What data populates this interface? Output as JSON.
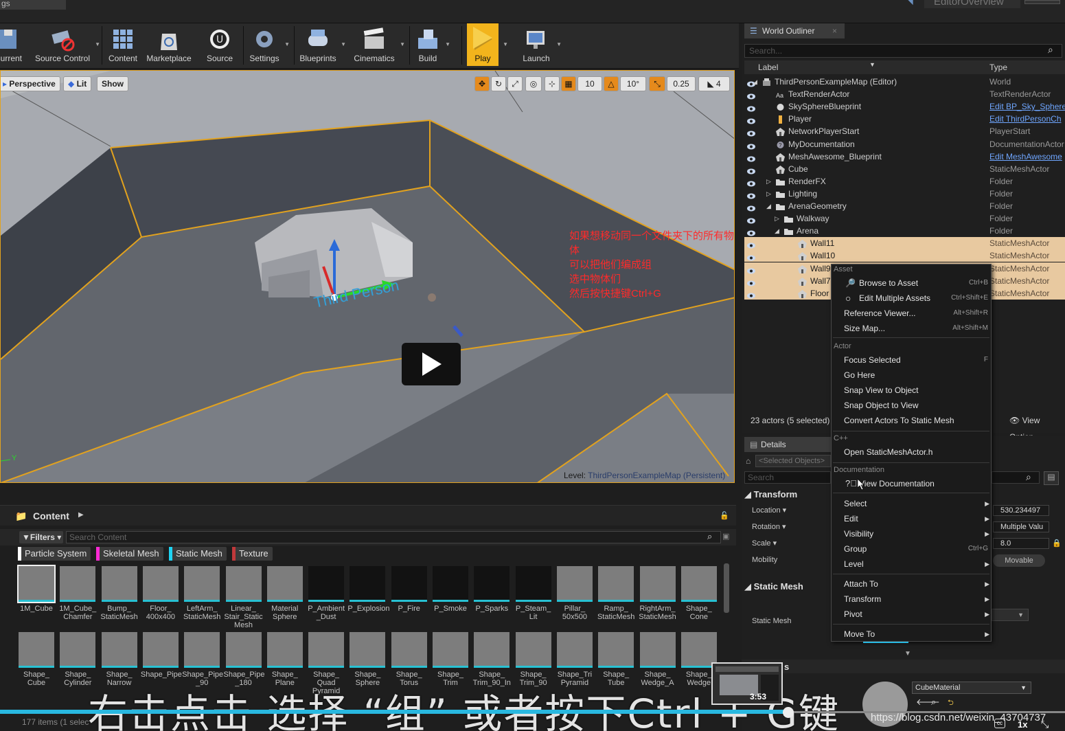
{
  "top": {
    "tab_fragment": "gs",
    "right_tab_fragment": "EditorOverview"
  },
  "toolbar": {
    "items": [
      {
        "label": "Current"
      },
      {
        "label": "Source Control"
      },
      {
        "label": "Content"
      },
      {
        "label": "Marketplace"
      },
      {
        "label": "Source"
      },
      {
        "label": "Settings"
      },
      {
        "label": "Blueprints"
      },
      {
        "label": "Cinematics"
      },
      {
        "label": "Build"
      },
      {
        "label": "Play"
      },
      {
        "label": "Launch"
      }
    ]
  },
  "viewport": {
    "perspective": "Perspective",
    "lit": "Lit",
    "show": "Show",
    "grid_snap": "10",
    "rot_snap": "10°",
    "scale_snap": "0.25",
    "cam_speed": "4",
    "annotation": [
      "如果想移动同一个文件夹下的所有物体",
      "可以把他们编成组",
      "选中物体们",
      "然后按快捷键Ctrl+G"
    ],
    "level_label": "Level:",
    "level_value": "ThirdPersonExampleMap (Persistent)",
    "axis_label": "Y"
  },
  "content_browser": {
    "title": "Content",
    "filters": "Filters",
    "search_placeholder": "Search Content",
    "chips": [
      {
        "label": "Particle System",
        "color": "#ffffff"
      },
      {
        "label": "Skeletal Mesh",
        "color": "#ff2ad4"
      },
      {
        "label": "Static Mesh",
        "color": "#1fd3f2"
      },
      {
        "label": "Texture",
        "color": "#c0393b"
      }
    ],
    "row1": [
      "1M_Cube",
      "1M_Cube_ Chamfer",
      "Bump_ StaticMesh",
      "Floor_ 400x400",
      "LeftArm_ StaticMesh",
      "Linear_ Stair_Static Mesh",
      "Material Sphere",
      "P_Ambient _Dust",
      "P_Explosion",
      "P_Fire",
      "P_Smoke",
      "P_Sparks",
      "P_Steam_ Lit",
      "Pillar_ 50x500",
      "Ramp_ StaticMesh",
      "RightArm_ StaticMesh",
      "Shape_ Cone"
    ],
    "row2": [
      "Shape_ Cube",
      "Shape_ Cylinder",
      "Shape_ Narrow",
      "Shape_Pipe",
      "Shape_Pipe _90",
      "Shape_Pipe _180",
      "Shape_ Plane",
      "Shape_ Quad Pyramid",
      "Shape_ Sphere",
      "Shape_ Torus",
      "Shape_ Trim",
      "Shape_ Trim_90_In",
      "Shape_ Trim_90",
      "Shape_Tri Pyramid",
      "Shape_ Tube",
      "Shape_ Wedge_A",
      "Shape_ Wedge"
    ],
    "item_count": "177 items (1 selec"
  },
  "outliner": {
    "tab": "World Outliner",
    "search_placeholder": "Search...",
    "col_label": "Label",
    "col_type": "Type",
    "rows": [
      {
        "label": "ThirdPersonExampleMap (Editor)",
        "type": "World"
      },
      {
        "label": "TextRenderActor",
        "type": "TextRenderActor"
      },
      {
        "label": "SkySphereBlueprint",
        "type": "Edit BP_Sky_Sphere"
      },
      {
        "label": "Player",
        "type": "Edit ThirdPersonCh"
      },
      {
        "label": "NetworkPlayerStart",
        "type": "PlayerStart"
      },
      {
        "label": "MyDocumentation",
        "type": "DocumentationActor"
      },
      {
        "label": "MeshAwesome_Blueprint",
        "type": "Edit MeshAwesome"
      },
      {
        "label": "Cube",
        "type": "StaticMeshActor"
      },
      {
        "label": "RenderFX",
        "type": "Folder"
      },
      {
        "label": "Lighting",
        "type": "Folder"
      },
      {
        "label": "ArenaGeometry",
        "type": "Folder"
      },
      {
        "label": "Walkway",
        "type": "Folder"
      },
      {
        "label": "Arena",
        "type": "Folder"
      },
      {
        "label": "Wall11",
        "type": "StaticMeshActor"
      },
      {
        "label": "Wall10",
        "type": "StaticMeshActor"
      },
      {
        "label": "Wall9",
        "type": "StaticMeshActor"
      },
      {
        "label": "Wall7",
        "type": "StaticMeshActor"
      },
      {
        "label": "Floor",
        "type": "StaticMeshActor"
      }
    ],
    "footer": "23 actors (5 selected)",
    "view_options": "View Option"
  },
  "details": {
    "tab": "Details",
    "selected": "<Selected Objects>",
    "search_placeholder": "Search",
    "transform": "Transform",
    "location": "Location",
    "rotation": "Rotation",
    "scale": "Scale",
    "mobility": "Mobility",
    "location_value": "530.234497",
    "rotation_value": "Multiple Valu",
    "scale_value": "8.0",
    "movable": "Movable",
    "static_mesh_section": "Static Mesh",
    "static_mesh_label": "Static Mesh",
    "materials_fragment": "s",
    "material_name": "CubeMaterial"
  },
  "context_menu": {
    "asset_header": "Asset",
    "browse": "Browse to Asset",
    "browse_sc": "Ctrl+B",
    "edit_multi": "Edit Multiple Assets",
    "edit_multi_sc": "Ctrl+Shift+E",
    "ref_viewer": "Reference Viewer...",
    "ref_viewer_sc": "Alt+Shift+R",
    "size_map": "Size Map...",
    "size_map_sc": "Alt+Shift+M",
    "actor_header": "Actor",
    "focus": "Focus Selected",
    "focus_sc": "F",
    "go_here": "Go Here",
    "snap_view": "Snap View to Object",
    "snap_obj": "Snap Object to View",
    "convert": "Convert Actors To Static Mesh",
    "cpp_header": "C++",
    "open_h": "Open StaticMeshActor.h",
    "doc_header": "Documentation",
    "view_doc": "View Documentation",
    "select": "Select",
    "edit": "Edit",
    "visibility": "Visibility",
    "group": "Group",
    "group_sc": "Ctrl+G",
    "level": "Level",
    "attach": "Attach To",
    "transform": "Transform",
    "pivot": "Pivot",
    "move_to": "Move To"
  },
  "video": {
    "subtitle": "右击点击 选择 “组” 或者按下Ctrl + G键",
    "preview_time": "3:53",
    "watermark": "https://blog.csdn.net/weixin_43704737",
    "speed": "1x",
    "progress_fraction": 0.74
  }
}
